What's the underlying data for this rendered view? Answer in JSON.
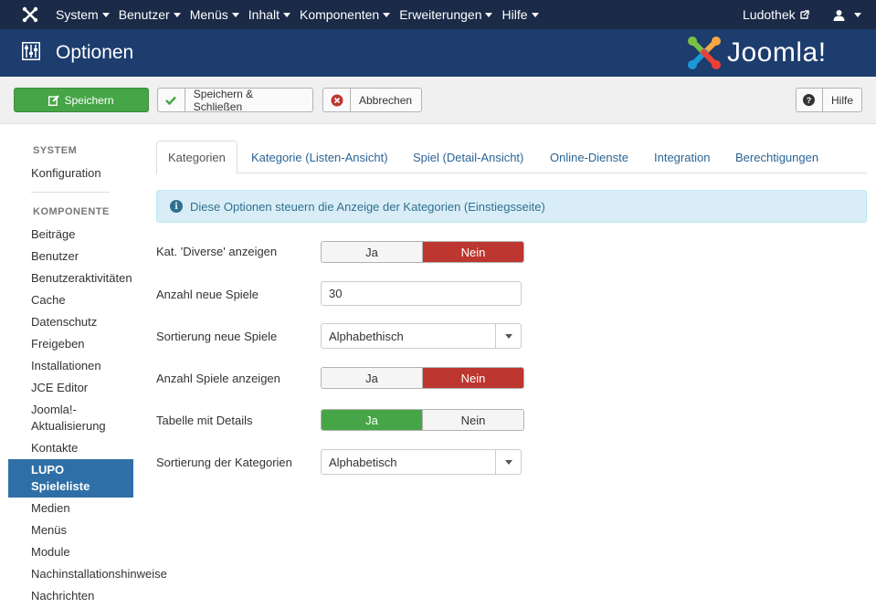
{
  "navbar": {
    "menu": [
      "System",
      "Benutzer",
      "Menüs",
      "Inhalt",
      "Komponenten",
      "Erweiterungen",
      "Hilfe"
    ],
    "site_name": "Ludothek"
  },
  "header": {
    "title": "Optionen",
    "brand": "Joomla!"
  },
  "toolbar": {
    "save": "Speichern",
    "save_close": "Speichern & Schließen",
    "cancel": "Abbrechen",
    "help": "Hilfe"
  },
  "sidebar": {
    "system_heading": "SYSTEM",
    "config": "Konfiguration",
    "components_heading": "KOMPONENTE",
    "items": [
      "Beiträge",
      "Benutzer",
      "Benutzeraktivitäten",
      "Cache",
      "Datenschutz",
      "Freigeben",
      "Installationen",
      "JCE Editor"
    ],
    "joomla_update_1": "Joomla!-",
    "joomla_update_2": "Aktualisierung",
    "contacts": "Kontakte",
    "active_1": "LUPO",
    "active_2": "Spieleliste",
    "items_after": [
      "Medien",
      "Menüs",
      "Module",
      "Nachinstallationshinweise",
      "Nachrichten"
    ]
  },
  "tabs": [
    "Kategorien",
    "Kategorie (Listen-Ansicht)",
    "Spiel (Detail-Ansicht)",
    "Online-Dienste",
    "Integration",
    "Berechtigungen"
  ],
  "alert": "Diese Optionen steuern die Anzeige der Kategorien (Einstiegsseite)",
  "form": {
    "f1_label": "Kat. 'Diverse' anzeigen",
    "f2_label": "Anzahl neue Spiele",
    "f2_value": "30",
    "f3_label": "Sortierung neue Spiele",
    "f3_value": "Alphabethisch",
    "f4_label": "Anzahl Spiele anzeigen",
    "f5_label": "Tabelle mit Details",
    "f6_label": "Sortierung der Kategorien",
    "f6_value": "Alphabetisch",
    "yes": "Ja",
    "no": "Nein"
  },
  "colors": {
    "navbar": "#1a2a47",
    "header": "#1c3d6e",
    "save_green": "#46a546",
    "no_red": "#bd362f",
    "active_blue": "#2f6fa7"
  },
  "icons": [
    "joomla-logo-icon",
    "external-link-icon",
    "user-icon",
    "options-sliders-icon",
    "edit-icon",
    "check-icon",
    "cancel-circle-icon",
    "help-question-icon",
    "info-icon",
    "chevron-down-icon"
  ]
}
